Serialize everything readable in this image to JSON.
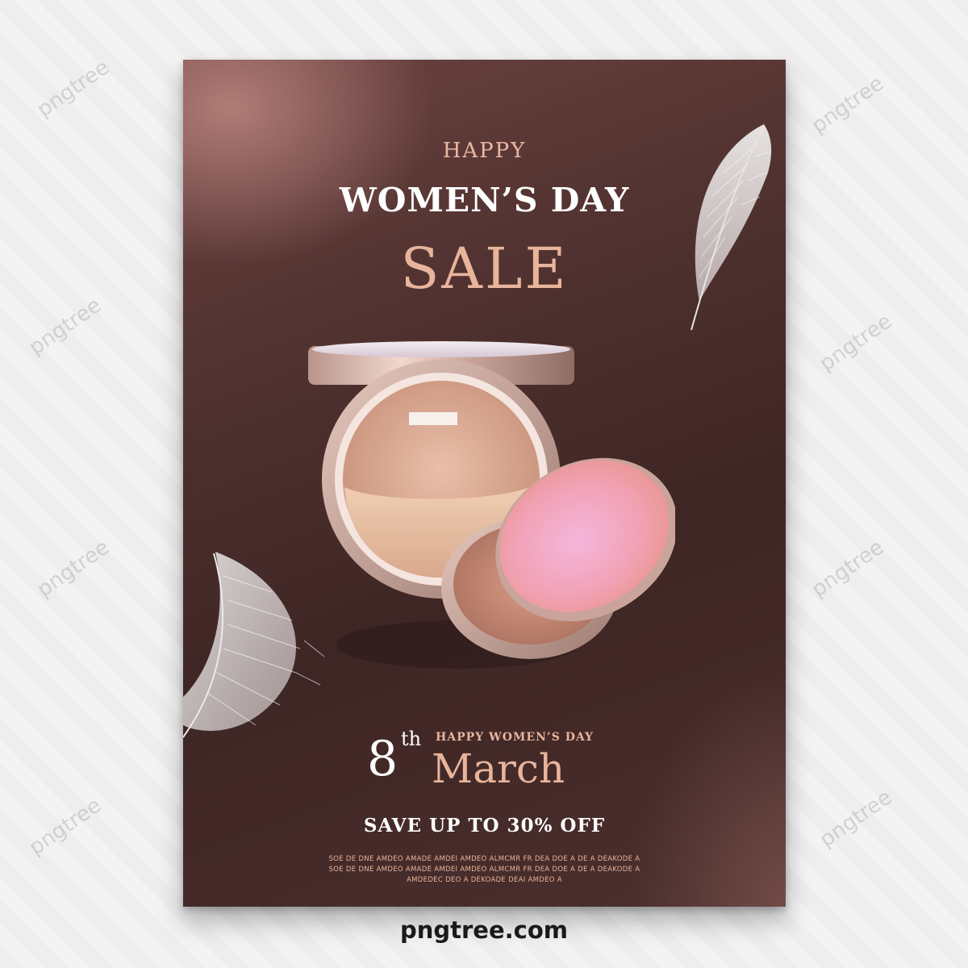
{
  "poster": {
    "happy": "HAPPY",
    "headline": "WOMEN’S DAY",
    "sale": "SALE",
    "date": {
      "day": "8",
      "suffix": "th",
      "caption": "HAPPY WOMEN’S DAY",
      "month": "March"
    },
    "offer": "SAVE UP TO 30% OFF",
    "fine_print": [
      "SOE DE DNE AMDEO AMADE AMDEI AMDEO ALMCMR FR DEA DOE A DE A DEAKODE A",
      "SOE DE DNE AMDEO AMADE AMDEI AMDEO ALMCMR FR DEA DOE A DE A DEAKODE A",
      "AMDEDEC DEO A DEKOADE  DEAI AMDEO A"
    ]
  },
  "watermark": "pngtree",
  "footer": {
    "logo_text": "pngtree.com"
  },
  "colors": {
    "rose_gold": "#e8b49c",
    "background_dark": "#4d302e",
    "white": "#ffffff"
  }
}
